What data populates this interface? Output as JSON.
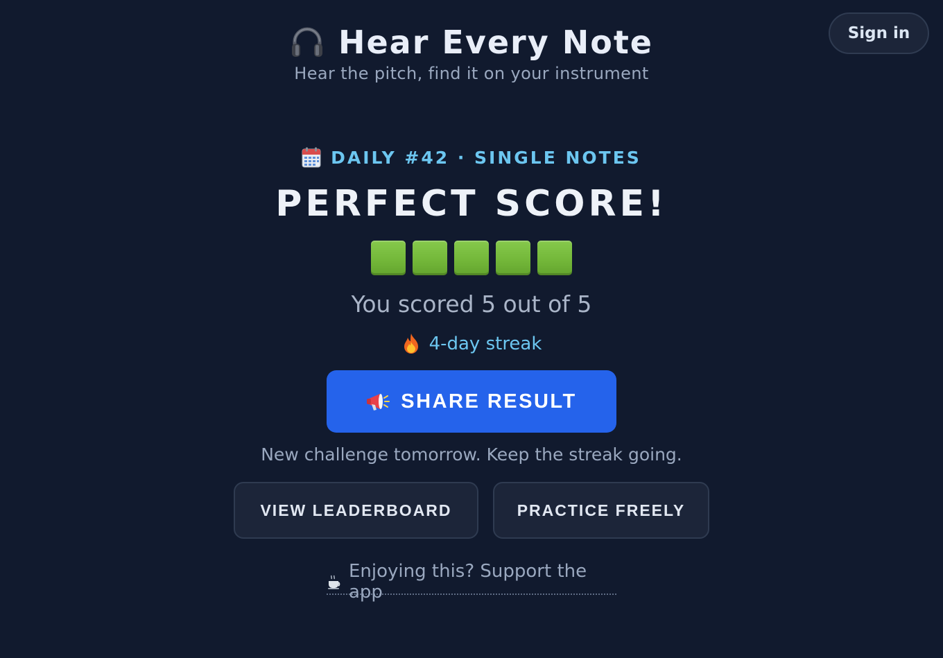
{
  "header": {
    "title": "Hear Every Note",
    "subtitle": "Hear the pitch, find it on your instrument",
    "icon": "headphones-icon"
  },
  "auth": {
    "sign_in_label": "Sign in"
  },
  "daily": {
    "icon": "calendar-icon",
    "label": "DAILY #42 · SINGLE NOTES"
  },
  "result": {
    "title": "PERFECT SCORE!",
    "score_text": "You scored 5 out of 5",
    "correct": 5,
    "total": 5,
    "square_color": "#74b83a"
  },
  "streak": {
    "icon": "fire-icon",
    "text": "4-day streak"
  },
  "share": {
    "icon": "megaphone-icon",
    "label": "SHARE RESULT",
    "color": "#2563eb"
  },
  "info": {
    "text": "New challenge tomorrow. Keep the streak going."
  },
  "actions": {
    "leaderboard_label": "VIEW LEADERBOARD",
    "practice_label": "PRACTICE FREELY"
  },
  "support": {
    "icon": "coffee-icon",
    "text": "Enjoying this? Support the app"
  },
  "colors": {
    "background": "#111a2e",
    "accent": "#6cc6f0",
    "muted_text": "#9aa8bf"
  }
}
